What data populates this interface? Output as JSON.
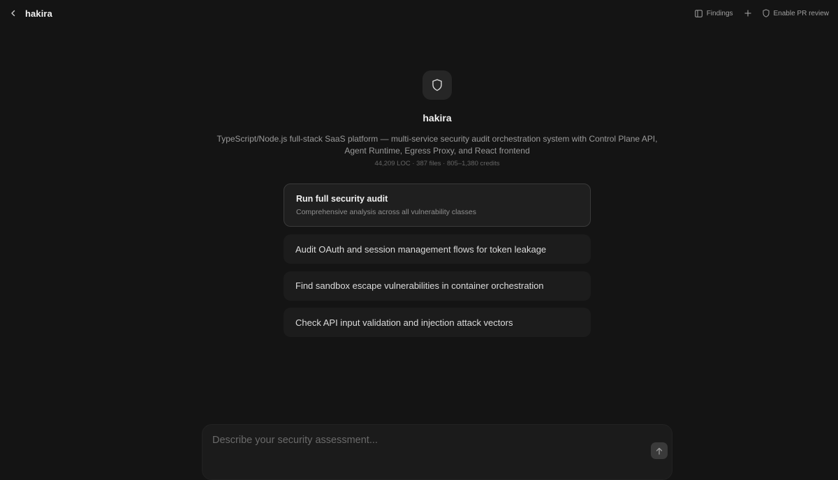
{
  "header": {
    "app_name": "hakira",
    "findings_label": "Findings",
    "pr_review_label": "Enable PR review"
  },
  "project": {
    "title": "hakira",
    "description": "TypeScript/Node.js full-stack SaaS platform — multi-service security audit orchestration system with Control Plane API, Agent Runtime, Egress Proxy, and React frontend",
    "meta": "44,209 LOC · 387 files · 805–1,380 credits"
  },
  "suggestions": {
    "primary": {
      "title": "Run full security audit",
      "subtitle": "Comprehensive analysis across all vulnerability classes"
    },
    "items": [
      "Audit OAuth and session management flows for token leakage",
      "Find sandbox escape vulnerabilities in container orchestration",
      "Check API input validation and injection attack vectors"
    ]
  },
  "composer": {
    "placeholder": "Describe your security assessment..."
  },
  "colors": {
    "background": "#141414",
    "card": "#1c1c1c",
    "card_border": "#3a3a3a"
  }
}
